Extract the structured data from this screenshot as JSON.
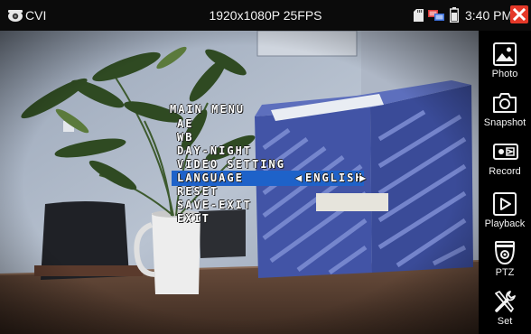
{
  "status_bar": {
    "mode": "CVI",
    "resolution": "1920x1080P 25FPS",
    "time": "3:40 PM"
  },
  "osd_menu": {
    "title": "MAIN MENU",
    "items": [
      {
        "label": "AE"
      },
      {
        "label": "WB"
      },
      {
        "label": "DAY-NIGHT"
      },
      {
        "label": "VIDEO SETTING"
      },
      {
        "label": "LANGUAGE",
        "value": "ENGLISH",
        "selected": true
      },
      {
        "label": "RESET"
      },
      {
        "label": "SAVE-EXIT"
      },
      {
        "label": "EXIT"
      }
    ],
    "highlight_color": "#1e62c9"
  },
  "sidebar": {
    "items": [
      {
        "label": "Photo",
        "icon": "photo-icon"
      },
      {
        "label": "Snapshot",
        "icon": "camera-icon"
      },
      {
        "label": "Record",
        "icon": "video-record-icon"
      },
      {
        "label": "Playback",
        "icon": "play-icon"
      },
      {
        "label": "PTZ",
        "icon": "ptz-camera-icon"
      },
      {
        "label": "Set",
        "icon": "tools-icon"
      }
    ]
  },
  "colors": {
    "close_button": "#e53828",
    "bar_background": "#0b0b0b",
    "sidebar_background": "#000000"
  }
}
